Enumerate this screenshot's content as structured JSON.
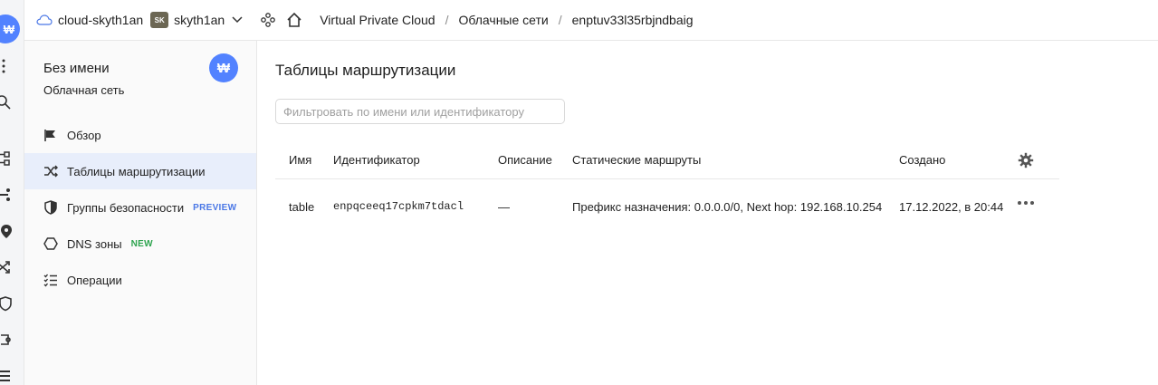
{
  "topbar": {
    "cloud_name": "cloud-skyth1an",
    "folder_badge": "SK",
    "folder_name": "skyth1an",
    "breadcrumbs": [
      "Virtual Private Cloud",
      "Облачные сети",
      "enptuv33l35rbjndbaig"
    ]
  },
  "rail": {
    "logo_glyph": "₩",
    "icons": [
      "apps-icon",
      "search-icon",
      "network-icon",
      "route-icon",
      "location-icon",
      "shuffle-icon",
      "shield-icon",
      "route-table-icon",
      "list-icon"
    ]
  },
  "sidebar": {
    "title": "Без имени",
    "subtitle": "Облачная сеть",
    "badge_glyph": "₩",
    "items": [
      {
        "label": "Обзор",
        "icon": "flag-icon",
        "active": false,
        "tag": ""
      },
      {
        "label": "Таблицы маршрутизации",
        "icon": "shuffle-icon",
        "active": true,
        "tag": ""
      },
      {
        "label": "Группы безопасности",
        "icon": "shield-icon",
        "active": false,
        "tag": "PREVIEW"
      },
      {
        "label": "DNS зоны",
        "icon": "hexagon-icon",
        "active": false,
        "tag": "NEW"
      },
      {
        "label": "Операции",
        "icon": "list-check-icon",
        "active": false,
        "tag": ""
      }
    ]
  },
  "main": {
    "title": "Таблицы маршрутизации",
    "filter_placeholder": "Фильтровать по имени или идентификатору",
    "columns": [
      "Имя",
      "Идентификатор",
      "Описание",
      "Статические маршруты",
      "Создано"
    ],
    "rows": [
      {
        "name": "table",
        "id": "enpqceeq17cpkm7tdacl",
        "description": "—",
        "routes_prefix_label": "Префикс назначения: ",
        "routes_prefix_value": "0.0.0.0/0",
        "routes_hop_label": ", Next hop: ",
        "routes_hop_value": "192.168.10.254",
        "created": "17.12.2022, в 20:44"
      }
    ]
  },
  "colors": {
    "accent": "#5282ff",
    "active_bg": "#e8eefb",
    "preview_tag": "#4b78e6",
    "new_tag": "#2ea44f"
  }
}
